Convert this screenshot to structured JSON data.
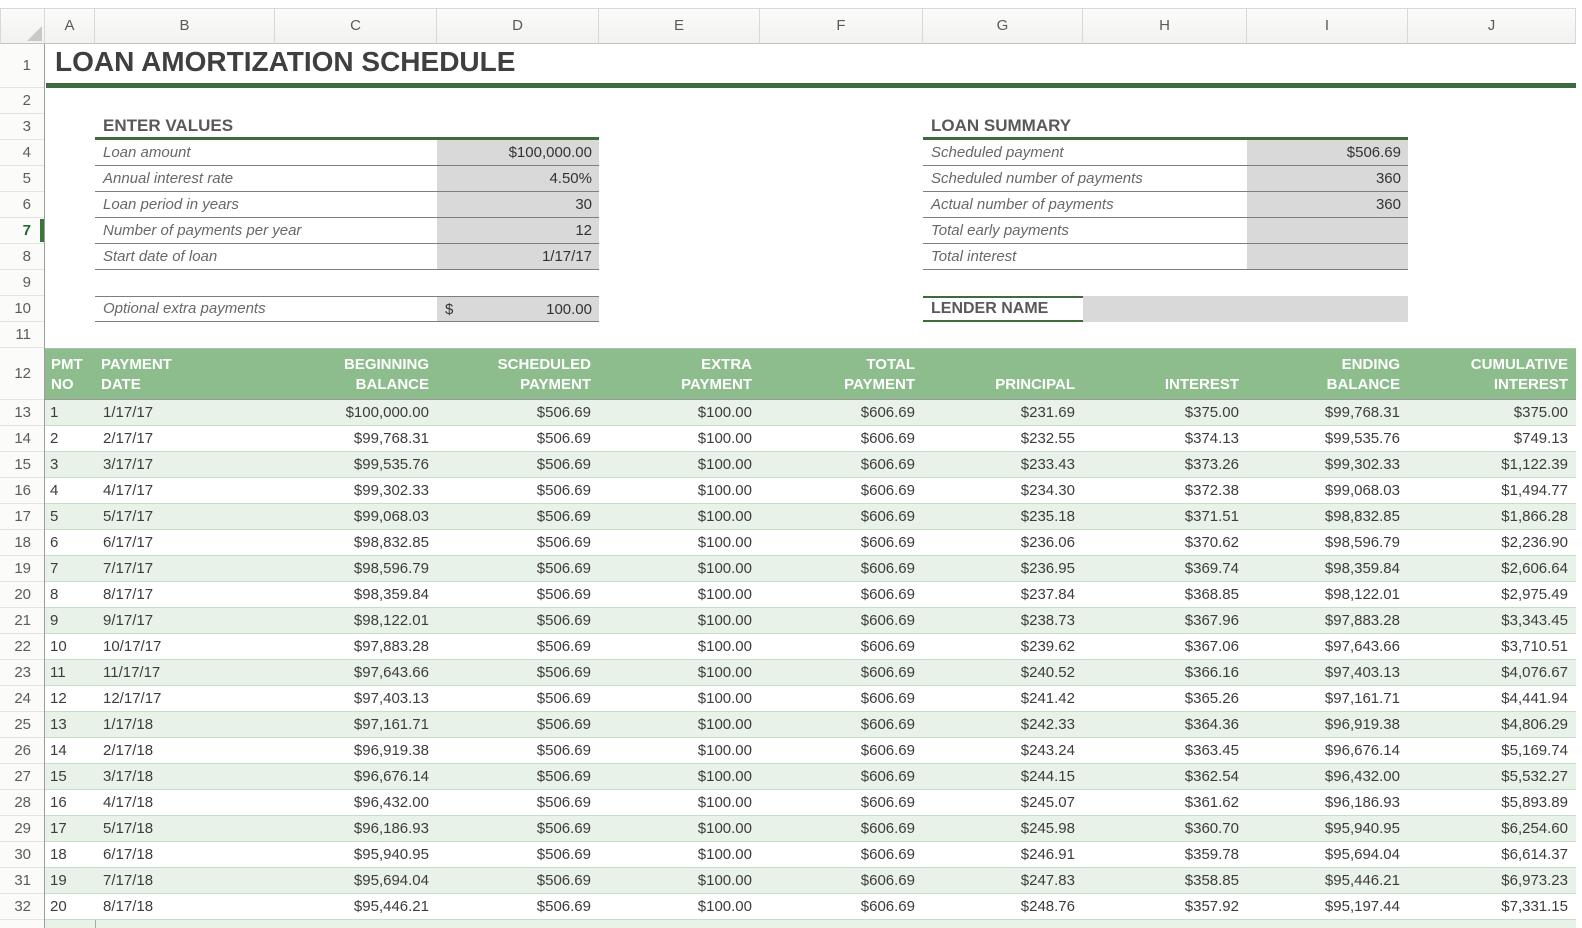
{
  "title": "LOAN AMORTIZATION SCHEDULE",
  "columns": [
    "A",
    "B",
    "C",
    "D",
    "E",
    "F",
    "G",
    "H",
    "I",
    "J"
  ],
  "row_numbers": [
    1,
    2,
    3,
    4,
    5,
    6,
    7,
    8,
    9,
    10,
    11,
    12,
    13,
    14,
    15,
    16,
    17,
    18,
    19,
    20,
    21,
    22,
    23,
    24,
    25,
    26,
    27,
    28,
    29,
    30,
    31,
    32
  ],
  "selected_row": 7,
  "enter_values": {
    "heading": "ENTER VALUES",
    "fields": [
      {
        "label": "Loan amount",
        "value": "$100,000.00"
      },
      {
        "label": "Annual interest rate",
        "value": "4.50%"
      },
      {
        "label": "Loan period in years",
        "value": "30"
      },
      {
        "label": "Number of payments per year",
        "value": "12"
      },
      {
        "label": "Start date of loan",
        "value": "1/17/17"
      }
    ],
    "extra": {
      "label": "Optional extra payments",
      "currency_symbol": "$",
      "value": "100.00"
    }
  },
  "loan_summary": {
    "heading": "LOAN SUMMARY",
    "fields": [
      {
        "label": "Scheduled payment",
        "value": "$506.69"
      },
      {
        "label": "Scheduled number of payments",
        "value": "360"
      },
      {
        "label": "Actual number of payments",
        "value": "360"
      },
      {
        "label": "Total early payments",
        "value": ""
      },
      {
        "label": "Total interest",
        "value": ""
      }
    ]
  },
  "lender": {
    "heading": "LENDER NAME",
    "value": ""
  },
  "table": {
    "headers": [
      [
        "PMT",
        "NO"
      ],
      [
        "PAYMENT",
        "DATE"
      ],
      [
        "BEGINNING",
        "BALANCE"
      ],
      [
        "SCHEDULED",
        "PAYMENT"
      ],
      [
        "EXTRA",
        "PAYMENT"
      ],
      [
        "TOTAL",
        "PAYMENT"
      ],
      [
        "",
        "PRINCIPAL"
      ],
      [
        "",
        "INTEREST"
      ],
      [
        "ENDING",
        "BALANCE"
      ],
      [
        "CUMULATIVE",
        "INTEREST"
      ]
    ],
    "rows": [
      [
        "1",
        "1/17/17",
        "$100,000.00",
        "$506.69",
        "$100.00",
        "$606.69",
        "$231.69",
        "$375.00",
        "$99,768.31",
        "$375.00"
      ],
      [
        "2",
        "2/17/17",
        "$99,768.31",
        "$506.69",
        "$100.00",
        "$606.69",
        "$232.55",
        "$374.13",
        "$99,535.76",
        "$749.13"
      ],
      [
        "3",
        "3/17/17",
        "$99,535.76",
        "$506.69",
        "$100.00",
        "$606.69",
        "$233.43",
        "$373.26",
        "$99,302.33",
        "$1,122.39"
      ],
      [
        "4",
        "4/17/17",
        "$99,302.33",
        "$506.69",
        "$100.00",
        "$606.69",
        "$234.30",
        "$372.38",
        "$99,068.03",
        "$1,494.77"
      ],
      [
        "5",
        "5/17/17",
        "$99,068.03",
        "$506.69",
        "$100.00",
        "$606.69",
        "$235.18",
        "$371.51",
        "$98,832.85",
        "$1,866.28"
      ],
      [
        "6",
        "6/17/17",
        "$98,832.85",
        "$506.69",
        "$100.00",
        "$606.69",
        "$236.06",
        "$370.62",
        "$98,596.79",
        "$2,236.90"
      ],
      [
        "7",
        "7/17/17",
        "$98,596.79",
        "$506.69",
        "$100.00",
        "$606.69",
        "$236.95",
        "$369.74",
        "$98,359.84",
        "$2,606.64"
      ],
      [
        "8",
        "8/17/17",
        "$98,359.84",
        "$506.69",
        "$100.00",
        "$606.69",
        "$237.84",
        "$368.85",
        "$98,122.01",
        "$2,975.49"
      ],
      [
        "9",
        "9/17/17",
        "$98,122.01",
        "$506.69",
        "$100.00",
        "$606.69",
        "$238.73",
        "$367.96",
        "$97,883.28",
        "$3,343.45"
      ],
      [
        "10",
        "10/17/17",
        "$97,883.28",
        "$506.69",
        "$100.00",
        "$606.69",
        "$239.62",
        "$367.06",
        "$97,643.66",
        "$3,710.51"
      ],
      [
        "11",
        "11/17/17",
        "$97,643.66",
        "$506.69",
        "$100.00",
        "$606.69",
        "$240.52",
        "$366.16",
        "$97,403.13",
        "$4,076.67"
      ],
      [
        "12",
        "12/17/17",
        "$97,403.13",
        "$506.69",
        "$100.00",
        "$606.69",
        "$241.42",
        "$365.26",
        "$97,161.71",
        "$4,441.94"
      ],
      [
        "13",
        "1/17/18",
        "$97,161.71",
        "$506.69",
        "$100.00",
        "$606.69",
        "$242.33",
        "$364.36",
        "$96,919.38",
        "$4,806.29"
      ],
      [
        "14",
        "2/17/18",
        "$96,919.38",
        "$506.69",
        "$100.00",
        "$606.69",
        "$243.24",
        "$363.45",
        "$96,676.14",
        "$5,169.74"
      ],
      [
        "15",
        "3/17/18",
        "$96,676.14",
        "$506.69",
        "$100.00",
        "$606.69",
        "$244.15",
        "$362.54",
        "$96,432.00",
        "$5,532.27"
      ],
      [
        "16",
        "4/17/18",
        "$96,432.00",
        "$506.69",
        "$100.00",
        "$606.69",
        "$245.07",
        "$361.62",
        "$96,186.93",
        "$5,893.89"
      ],
      [
        "17",
        "5/17/18",
        "$96,186.93",
        "$506.69",
        "$100.00",
        "$606.69",
        "$245.98",
        "$360.70",
        "$95,940.95",
        "$6,254.60"
      ],
      [
        "18",
        "6/17/18",
        "$95,940.95",
        "$506.69",
        "$100.00",
        "$606.69",
        "$246.91",
        "$359.78",
        "$95,694.04",
        "$6,614.37"
      ],
      [
        "19",
        "7/17/18",
        "$95,694.04",
        "$506.69",
        "$100.00",
        "$606.69",
        "$247.83",
        "$358.85",
        "$95,446.21",
        "$6,973.23"
      ],
      [
        "20",
        "8/17/18",
        "$95,446.21",
        "$506.69",
        "$100.00",
        "$606.69",
        "$248.76",
        "$357.92",
        "$95,197.44",
        "$7,331.15"
      ]
    ]
  },
  "colors": {
    "accent_dark_green": "#3d6b3d",
    "table_header_green": "#8dbd8d",
    "stripe_green": "#e9f2e9",
    "value_cell_gray": "#d9d9d9",
    "selected_row_green": "#38773c"
  }
}
